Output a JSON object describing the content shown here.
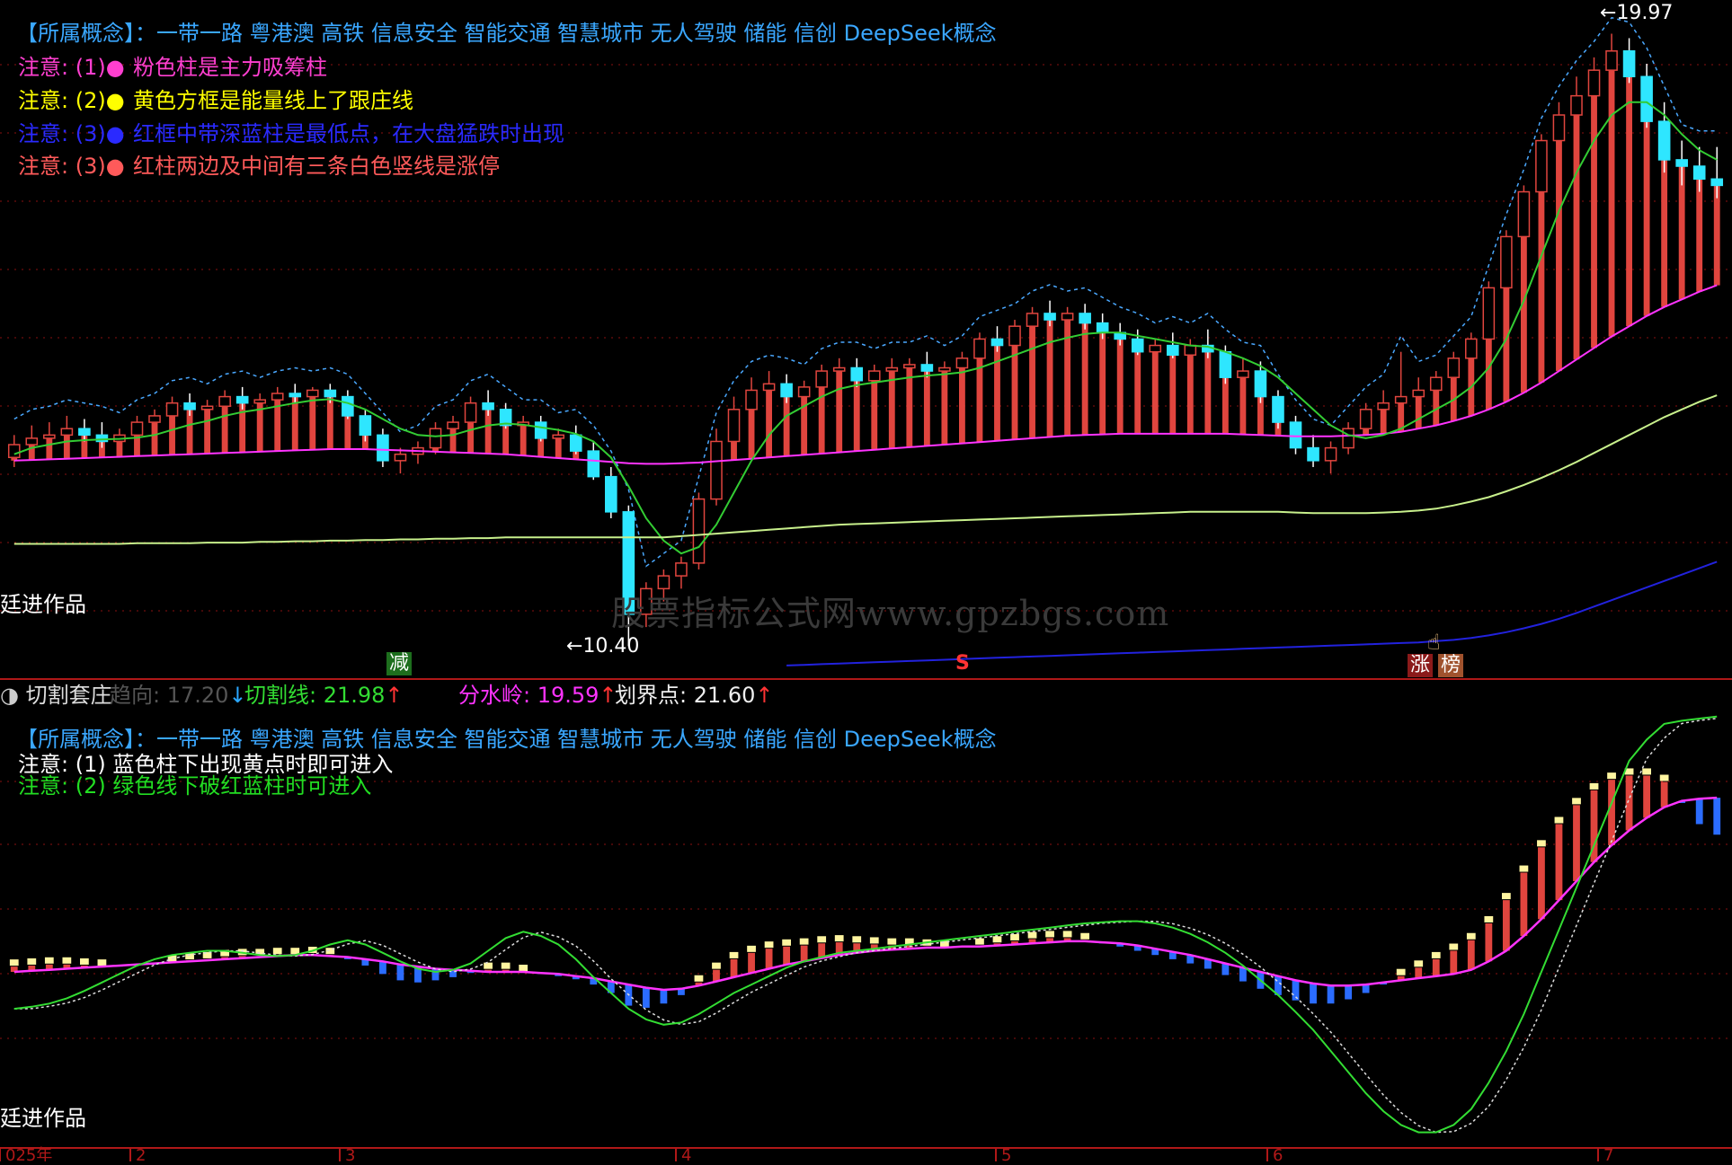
{
  "colors": {
    "background": "#000000",
    "grid": "#8a1010",
    "concept": "#3aa7ff",
    "bar_up": "#e0453e",
    "bar_cyan": "#2ee6ff",
    "bar_blue": "#2b6cff",
    "ma_magenta": "#ff33ff",
    "ma_green": "#33cc33",
    "ma_yellowgreen": "#c8f08c",
    "ma_blue": "#2222dd",
    "dash_band": "#4aa8ff"
  },
  "top_panel": {
    "concept_line": "【所属概念】：一带一路 粤港澳 高铁 信息安全 智能交通 智慧城市 无人驾驶 储能 信创 DeepSeek概念",
    "notes": [
      {
        "label": "注意: (1)●",
        "text": "粉色柱是主力吸筹柱"
      },
      {
        "label": "注意: (2)●",
        "text": "黄色方框是能量线上了跟庄线"
      },
      {
        "label": "注意: (3)●",
        "text": "红框中带深蓝柱是最低点，在大盘猛跌时出现"
      },
      {
        "label": "注意: (3)●",
        "text": "红柱两边及中间有三条白色竖线是涨停"
      }
    ],
    "author": "廷进作品",
    "max_label": "19.97",
    "min_label": "10.40",
    "signal_jian": "减",
    "signal_s": "S",
    "signal_zhang": "涨",
    "signal_bang": "榜",
    "watermark": "股票指标公式网www.gpzbgs.com"
  },
  "indicator_header": {
    "name": "切割套庄",
    "trend_label": "趋向: 17.20",
    "trend_arrow": "↓",
    "cut_label": "切割线: 21.98",
    "cut_arrow": "↑",
    "water_label": "分水岭: 19.59",
    "water_arrow": "↑",
    "boundary_label": "划界点: 21.60",
    "boundary_arrow": "↑"
  },
  "bottom_panel": {
    "concept_line": "【所属概念】：一带一路 粤港澳 高铁 信息安全 智能交通 智慧城市 无人驾驶 储能 信创 DeepSeek概念",
    "note1": "注意: (1) 蓝色柱下出现黄点时即可进入",
    "note2": "注意: (2) 绿色线下破红蓝柱时可进入",
    "author": "廷进作品"
  },
  "x_axis": {
    "labels": [
      "025年",
      "2",
      "3",
      "4",
      "5",
      "6",
      "7"
    ]
  },
  "chart_data": [
    {
      "type": "candlestick",
      "title": "",
      "ylim": [
        10.0,
        20.3
      ],
      "candles": [
        [
          13.35,
          13.7,
          13.2,
          13.55
        ],
        [
          13.55,
          13.85,
          13.4,
          13.65
        ],
        [
          13.65,
          13.9,
          13.5,
          13.7
        ],
        [
          13.7,
          14.0,
          13.55,
          13.8
        ],
        [
          13.8,
          13.95,
          13.6,
          13.7
        ],
        [
          13.7,
          13.9,
          13.5,
          13.6
        ],
        [
          13.6,
          13.8,
          13.45,
          13.7
        ],
        [
          13.7,
          14.0,
          13.6,
          13.9
        ],
        [
          13.9,
          14.1,
          13.75,
          14.0
        ],
        [
          14.0,
          14.3,
          13.9,
          14.2
        ],
        [
          14.2,
          14.35,
          14.0,
          14.1
        ],
        [
          14.1,
          14.25,
          13.95,
          14.15
        ],
        [
          14.15,
          14.4,
          14.05,
          14.3
        ],
        [
          14.3,
          14.45,
          14.1,
          14.2
        ],
        [
          14.2,
          14.35,
          14.05,
          14.25
        ],
        [
          14.25,
          14.45,
          14.1,
          14.35
        ],
        [
          14.35,
          14.5,
          14.2,
          14.3
        ],
        [
          14.3,
          14.45,
          14.15,
          14.4
        ],
        [
          14.4,
          14.5,
          14.2,
          14.3
        ],
        [
          14.3,
          14.4,
          13.95,
          14.0
        ],
        [
          14.0,
          14.1,
          13.6,
          13.7
        ],
        [
          13.7,
          13.8,
          13.2,
          13.3
        ],
        [
          13.3,
          13.5,
          13.1,
          13.4
        ],
        [
          13.4,
          13.6,
          13.25,
          13.5
        ],
        [
          13.5,
          13.9,
          13.4,
          13.8
        ],
        [
          13.8,
          14.0,
          13.65,
          13.9
        ],
        [
          13.9,
          14.3,
          13.8,
          14.2
        ],
        [
          14.2,
          14.4,
          14.0,
          14.1
        ],
        [
          14.1,
          14.2,
          13.8,
          13.85
        ],
        [
          13.85,
          14.0,
          13.7,
          13.9
        ],
        [
          13.9,
          14.0,
          13.6,
          13.65
        ],
        [
          13.65,
          13.8,
          13.5,
          13.7
        ],
        [
          13.7,
          13.85,
          13.4,
          13.45
        ],
        [
          13.45,
          13.6,
          13.0,
          13.05
        ],
        [
          13.05,
          13.2,
          12.4,
          12.5
        ],
        [
          12.5,
          12.6,
          10.4,
          10.9
        ],
        [
          10.9,
          11.4,
          10.7,
          11.3
        ],
        [
          11.3,
          11.6,
          11.1,
          11.5
        ],
        [
          11.5,
          11.8,
          11.3,
          11.7
        ],
        [
          11.7,
          12.8,
          11.6,
          12.7
        ],
        [
          12.7,
          13.8,
          12.6,
          13.6
        ],
        [
          13.6,
          14.3,
          13.4,
          14.1
        ],
        [
          14.1,
          14.6,
          13.9,
          14.4
        ],
        [
          14.4,
          14.7,
          14.2,
          14.5
        ],
        [
          14.5,
          14.65,
          14.2,
          14.3
        ],
        [
          14.3,
          14.55,
          14.1,
          14.45
        ],
        [
          14.45,
          14.8,
          14.3,
          14.7
        ],
        [
          14.7,
          14.9,
          14.5,
          14.75
        ],
        [
          14.75,
          14.9,
          14.45,
          14.55
        ],
        [
          14.55,
          14.8,
          14.4,
          14.7
        ],
        [
          14.7,
          14.9,
          14.55,
          14.75
        ],
        [
          14.75,
          14.9,
          14.6,
          14.8
        ],
        [
          14.8,
          15.0,
          14.6,
          14.7
        ],
        [
          14.7,
          14.85,
          14.5,
          14.75
        ],
        [
          14.75,
          15.0,
          14.6,
          14.9
        ],
        [
          14.9,
          15.3,
          14.8,
          15.2
        ],
        [
          15.2,
          15.4,
          15.0,
          15.1
        ],
        [
          15.1,
          15.5,
          15.0,
          15.4
        ],
        [
          15.4,
          15.7,
          15.3,
          15.6
        ],
        [
          15.6,
          15.8,
          15.4,
          15.5
        ],
        [
          15.5,
          15.7,
          15.3,
          15.6
        ],
        [
          15.6,
          15.75,
          15.35,
          15.45
        ],
        [
          15.45,
          15.6,
          15.2,
          15.3
        ],
        [
          15.3,
          15.45,
          15.1,
          15.2
        ],
        [
          15.2,
          15.35,
          14.95,
          15.0
        ],
        [
          15.0,
          15.2,
          14.85,
          15.1
        ],
        [
          15.1,
          15.3,
          14.9,
          14.95
        ],
        [
          14.95,
          15.2,
          14.8,
          15.1
        ],
        [
          15.1,
          15.35,
          14.9,
          15.0
        ],
        [
          15.0,
          15.1,
          14.5,
          14.6
        ],
        [
          14.6,
          14.9,
          14.3,
          14.7
        ],
        [
          14.7,
          14.85,
          14.2,
          14.3
        ],
        [
          14.3,
          14.4,
          13.8,
          13.9
        ],
        [
          13.9,
          14.0,
          13.4,
          13.5
        ],
        [
          13.5,
          13.7,
          13.2,
          13.3
        ],
        [
          13.3,
          13.6,
          13.1,
          13.5
        ],
        [
          13.5,
          13.9,
          13.4,
          13.8
        ],
        [
          13.8,
          14.2,
          13.7,
          14.1
        ],
        [
          14.1,
          14.4,
          13.9,
          14.2
        ],
        [
          14.2,
          15.0,
          14.1,
          14.3
        ],
        [
          14.3,
          14.6,
          14.1,
          14.4
        ],
        [
          14.4,
          14.7,
          14.3,
          14.6
        ],
        [
          14.6,
          15.0,
          14.5,
          14.9
        ],
        [
          14.9,
          15.3,
          14.8,
          15.2
        ],
        [
          15.2,
          16.1,
          15.1,
          16.0
        ],
        [
          16.0,
          16.9,
          15.9,
          16.8
        ],
        [
          16.8,
          17.6,
          16.7,
          17.5
        ],
        [
          17.5,
          18.4,
          17.4,
          18.3
        ],
        [
          18.3,
          18.9,
          18.1,
          18.7
        ],
        [
          18.7,
          19.3,
          18.5,
          19.0
        ],
        [
          19.0,
          19.6,
          18.8,
          19.4
        ],
        [
          19.4,
          19.97,
          19.2,
          19.7
        ],
        [
          19.7,
          19.9,
          19.2,
          19.3
        ],
        [
          19.3,
          19.5,
          18.5,
          18.6
        ],
        [
          18.6,
          18.9,
          17.8,
          18.0
        ],
        [
          18.0,
          18.3,
          17.6,
          17.9
        ],
        [
          17.9,
          18.2,
          17.5,
          17.7
        ],
        [
          17.7,
          18.2,
          17.4,
          17.6
        ]
      ],
      "ma_green": [
        13.4,
        13.5,
        13.55,
        13.6,
        13.62,
        13.63,
        13.64,
        13.66,
        13.7,
        13.78,
        13.86,
        13.92,
        14.0,
        14.06,
        14.1,
        14.15,
        14.2,
        14.24,
        14.26,
        14.2,
        14.1,
        13.95,
        13.8,
        13.7,
        13.68,
        13.7,
        13.78,
        13.85,
        13.88,
        13.86,
        13.82,
        13.78,
        13.72,
        13.6,
        13.35,
        12.9,
        12.4,
        12.05,
        11.85,
        11.95,
        12.3,
        12.8,
        13.3,
        13.7,
        14.0,
        14.15,
        14.3,
        14.42,
        14.48,
        14.52,
        14.56,
        14.6,
        14.63,
        14.65,
        14.68,
        14.75,
        14.85,
        14.95,
        15.05,
        15.15,
        15.22,
        15.28,
        15.3,
        15.3,
        15.25,
        15.2,
        15.15,
        15.1,
        15.08,
        15.0,
        14.9,
        14.78,
        14.6,
        14.35,
        14.1,
        13.85,
        13.7,
        13.65,
        13.7,
        13.8,
        13.95,
        14.1,
        14.25,
        14.45,
        14.75,
        15.2,
        15.8,
        16.5,
        17.2,
        17.8,
        18.3,
        18.7,
        18.9,
        18.9,
        18.7,
        18.4,
        18.15,
        18.0
      ],
      "ma_magenta": [
        13.3,
        13.31,
        13.32,
        13.33,
        13.34,
        13.35,
        13.36,
        13.37,
        13.38,
        13.39,
        13.4,
        13.41,
        13.42,
        13.43,
        13.44,
        13.45,
        13.46,
        13.47,
        13.48,
        13.48,
        13.48,
        13.47,
        13.46,
        13.45,
        13.44,
        13.43,
        13.42,
        13.41,
        13.4,
        13.38,
        13.36,
        13.34,
        13.32,
        13.3,
        13.28,
        13.26,
        13.25,
        13.25,
        13.26,
        13.27,
        13.29,
        13.31,
        13.33,
        13.35,
        13.37,
        13.39,
        13.41,
        13.43,
        13.45,
        13.47,
        13.49,
        13.51,
        13.53,
        13.55,
        13.57,
        13.59,
        13.61,
        13.63,
        13.65,
        13.67,
        13.69,
        13.7,
        13.71,
        13.72,
        13.72,
        13.72,
        13.72,
        13.72,
        13.72,
        13.72,
        13.71,
        13.7,
        13.69,
        13.68,
        13.68,
        13.68,
        13.69,
        13.7,
        13.72,
        13.75,
        13.8,
        13.85,
        13.92,
        14.0,
        14.1,
        14.22,
        14.36,
        14.52,
        14.7,
        14.88,
        15.06,
        15.24,
        15.4,
        15.56,
        15.7,
        15.82,
        15.94,
        16.04
      ],
      "ma_yellowgreen": [
        12.0,
        12.0,
        12.0,
        12.0,
        12.0,
        12.0,
        12.0,
        12.01,
        12.01,
        12.01,
        12.01,
        12.02,
        12.02,
        12.02,
        12.03,
        12.03,
        12.04,
        12.04,
        12.05,
        12.05,
        12.06,
        12.06,
        12.07,
        12.07,
        12.08,
        12.08,
        12.09,
        12.09,
        12.1,
        12.1,
        12.1,
        12.1,
        12.1,
        12.1,
        12.1,
        12.1,
        12.1,
        12.1,
        12.12,
        12.14,
        12.16,
        12.18,
        12.2,
        12.22,
        12.24,
        12.26,
        12.28,
        12.3,
        12.31,
        12.32,
        12.33,
        12.34,
        12.35,
        12.36,
        12.37,
        12.38,
        12.39,
        12.4,
        12.41,
        12.42,
        12.43,
        12.44,
        12.45,
        12.46,
        12.47,
        12.48,
        12.49,
        12.5,
        12.5,
        12.5,
        12.5,
        12.5,
        12.5,
        12.49,
        12.48,
        12.48,
        12.48,
        12.48,
        12.49,
        12.5,
        12.52,
        12.55,
        12.6,
        12.66,
        12.73,
        12.82,
        12.92,
        13.03,
        13.15,
        13.28,
        13.42,
        13.56,
        13.7,
        13.84,
        13.98,
        14.1,
        14.22,
        14.32
      ],
      "ma_blue_start_index": 44,
      "ma_blue": [
        10.1,
        10.11,
        10.12,
        10.13,
        10.14,
        10.15,
        10.16,
        10.17,
        10.18,
        10.19,
        10.2,
        10.21,
        10.22,
        10.23,
        10.24,
        10.25,
        10.26,
        10.27,
        10.28,
        10.29,
        10.3,
        10.31,
        10.32,
        10.33,
        10.34,
        10.35,
        10.36,
        10.37,
        10.38,
        10.39,
        10.4,
        10.41,
        10.42,
        10.43,
        10.44,
        10.45,
        10.46,
        10.48,
        10.5,
        10.53,
        10.57,
        10.62,
        10.68,
        10.75,
        10.83,
        10.92,
        11.02,
        11.12,
        11.22,
        11.32,
        11.42,
        11.52,
        11.62,
        11.72
      ]
    },
    {
      "type": "bar",
      "title": "切割套庄",
      "ylim": [
        -1.6,
        2.4
      ],
      "values": [
        0.05,
        0.06,
        0.07,
        0.07,
        0.06,
        0.05,
        0.05,
        0.06,
        0.07,
        0.09,
        0.11,
        0.12,
        0.14,
        0.15,
        0.15,
        0.16,
        0.16,
        0.17,
        0.16,
        0.12,
        0.06,
        -0.02,
        -0.08,
        -0.1,
        -0.08,
        -0.05,
        -0.01,
        0.02,
        0.02,
        0.0,
        -0.02,
        -0.04,
        -0.07,
        -0.12,
        -0.2,
        -0.32,
        -0.34,
        -0.3,
        -0.22,
        -0.1,
        0.02,
        0.12,
        0.18,
        0.22,
        0.24,
        0.25,
        0.27,
        0.28,
        0.27,
        0.26,
        0.25,
        0.25,
        0.24,
        0.23,
        0.23,
        0.25,
        0.27,
        0.29,
        0.31,
        0.32,
        0.32,
        0.3,
        0.27,
        0.24,
        0.2,
        0.16,
        0.12,
        0.08,
        0.03,
        -0.03,
        -0.09,
        -0.16,
        -0.22,
        -0.27,
        -0.3,
        -0.3,
        -0.26,
        -0.2,
        -0.12,
        -0.04,
        0.04,
        0.12,
        0.2,
        0.3,
        0.46,
        0.68,
        0.94,
        1.18,
        1.4,
        1.58,
        1.72,
        1.82,
        1.86,
        1.86,
        1.8,
        1.6,
        1.4,
        1.3
      ],
      "line_magenta": [
        0.0,
        0.01,
        0.02,
        0.03,
        0.04,
        0.05,
        0.06,
        0.07,
        0.08,
        0.09,
        0.1,
        0.11,
        0.12,
        0.13,
        0.14,
        0.15,
        0.16,
        0.16,
        0.15,
        0.14,
        0.12,
        0.1,
        0.07,
        0.05,
        0.03,
        0.02,
        0.01,
        0.0,
        0.0,
        0.0,
        -0.01,
        -0.02,
        -0.04,
        -0.06,
        -0.09,
        -0.12,
        -0.15,
        -0.17,
        -0.16,
        -0.13,
        -0.09,
        -0.05,
        -0.01,
        0.03,
        0.07,
        0.1,
        0.13,
        0.16,
        0.18,
        0.2,
        0.21,
        0.22,
        0.23,
        0.23,
        0.24,
        0.24,
        0.25,
        0.26,
        0.27,
        0.28,
        0.29,
        0.29,
        0.28,
        0.27,
        0.25,
        0.22,
        0.19,
        0.16,
        0.12,
        0.08,
        0.04,
        0.0,
        -0.04,
        -0.08,
        -0.11,
        -0.13,
        -0.13,
        -0.12,
        -0.1,
        -0.08,
        -0.06,
        -0.04,
        -0.02,
        0.02,
        0.1,
        0.2,
        0.34,
        0.5,
        0.68,
        0.86,
        1.04,
        1.2,
        1.34,
        1.46,
        1.56,
        1.62,
        1.64,
        1.65
      ],
      "line_green": [
        -0.35,
        -0.33,
        -0.3,
        -0.25,
        -0.18,
        -0.1,
        -0.02,
        0.06,
        0.12,
        0.16,
        0.18,
        0.2,
        0.2,
        0.18,
        0.16,
        0.15,
        0.16,
        0.2,
        0.26,
        0.3,
        0.26,
        0.18,
        0.1,
        0.03,
        0.0,
        0.02,
        0.08,
        0.2,
        0.32,
        0.38,
        0.34,
        0.26,
        0.12,
        -0.05,
        -0.2,
        -0.35,
        -0.45,
        -0.5,
        -0.48,
        -0.4,
        -0.3,
        -0.2,
        -0.12,
        -0.04,
        0.04,
        0.1,
        0.14,
        0.18,
        0.2,
        0.22,
        0.24,
        0.26,
        0.28,
        0.3,
        0.32,
        0.34,
        0.36,
        0.38,
        0.4,
        0.42,
        0.44,
        0.46,
        0.47,
        0.48,
        0.48,
        0.46,
        0.42,
        0.36,
        0.28,
        0.18,
        0.06,
        -0.08,
        -0.22,
        -0.38,
        -0.55,
        -0.75,
        -0.95,
        -1.15,
        -1.32,
        -1.45,
        -1.52,
        -1.52,
        -1.45,
        -1.3,
        -1.05,
        -0.75,
        -0.4,
        0.0,
        0.4,
        0.8,
        1.2,
        1.6,
        2.0,
        2.2,
        2.35,
        2.38,
        2.4,
        2.42
      ]
    }
  ]
}
